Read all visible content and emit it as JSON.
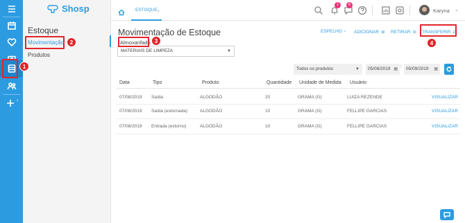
{
  "brand": {
    "name": "Shosp",
    "color": "#2d9be0"
  },
  "rail": {
    "icons": [
      "menu-icon",
      "calendar-icon",
      "heart-icon",
      "wallet-icon",
      "inventory-icon",
      "people-icon",
      "add-icon"
    ]
  },
  "subnav": {
    "title": "Estoque",
    "items": [
      {
        "label": "Movimentação"
      },
      {
        "label": "Produtos"
      }
    ]
  },
  "topbar": {
    "tab_label": "ESTOQUE",
    "notifications_badge": "1",
    "messages_badge": "8",
    "user_name": "Karyna"
  },
  "page": {
    "title": "Movimentação de Estoque",
    "actions": {
      "espelho": "ESPELHO",
      "adicionar": "ADICIONAR",
      "retirar": "RETIRAR",
      "transferir": "TRANSFERIR"
    },
    "almox_label": "Almoxarifado",
    "almox_value": "MATERIAIS DE LIMPEZA"
  },
  "filters": {
    "product": "Todos os produtos",
    "date_from": "05/08/2019",
    "date_to": "05/09/2019"
  },
  "table": {
    "headers": {
      "data": "Data",
      "tipo": "Tipo",
      "produto": "Produto",
      "quantidade": "Quantidade",
      "unidade": "Unidade de Medida",
      "usuario": "Usuário"
    },
    "rows": [
      {
        "data": "07/08/2019",
        "tipo": "Saída",
        "produto": "ALGODÃO",
        "quantidade": "20",
        "unidade": "GRAMA (G)",
        "usuario": "LUIZA REZENDE",
        "action": "VISUALIZAR"
      },
      {
        "data": "07/08/2019",
        "tipo": "Saída (estornada)",
        "produto": "ALGODÃO",
        "quantidade": "10",
        "unidade": "GRAMA (G)",
        "usuario": "FELLIPE GARCIAS",
        "action": "VISUALIZAR"
      },
      {
        "data": "07/08/2019",
        "tipo": "Entrada (estorno)",
        "produto": "ALGODÃO",
        "quantidade": "10",
        "unidade": "GRAMA (G)",
        "usuario": "FELLIPE GARCIAS",
        "action": "VISUALIZAR"
      }
    ]
  },
  "callouts": [
    "1",
    "2",
    "3",
    "4"
  ]
}
